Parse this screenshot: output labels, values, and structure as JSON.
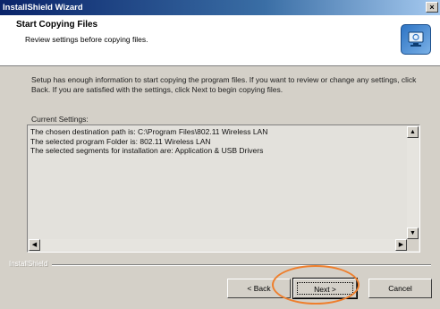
{
  "window": {
    "title": "InstallShield Wizard",
    "close_label": "×"
  },
  "header": {
    "title": "Start Copying Files",
    "subtitle": "Review settings before copying files.",
    "logo_icon": "installshield-computer-icon"
  },
  "body": {
    "intro": "Setup has enough information to start copying the program files. If you want to review or change any settings, click Back. If you are satisfied with the settings, click Next to begin copying files.",
    "current_settings_label": "Current Settings:",
    "settings_lines": [
      "The chosen destination path is: C:\\Program Files\\802.11 Wireless LAN",
      "The selected program Folder is: 802.11 Wireless LAN",
      "The selected segments for installation are: Application & USB Drivers"
    ]
  },
  "footer": {
    "brand": "InstallShield",
    "back_label": "< Back",
    "next_label": "Next >",
    "cancel_label": "Cancel"
  },
  "colors": {
    "highlight": "#ee7f2d",
    "titlebar": "#0a246a"
  }
}
